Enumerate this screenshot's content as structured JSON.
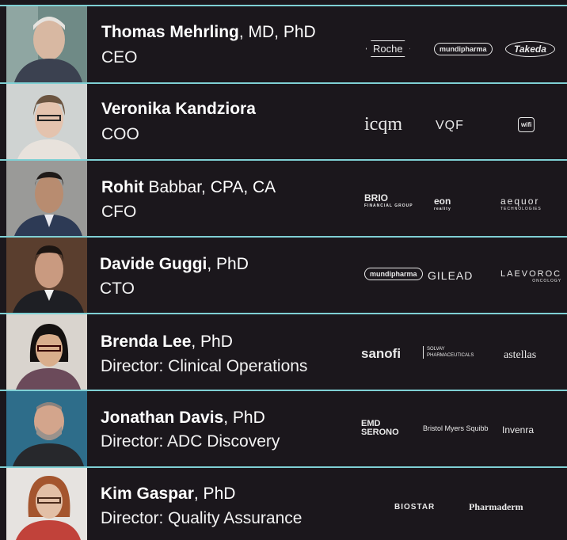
{
  "members": [
    {
      "name_bold": "Thomas Mehrling",
      "name_rest": ", MD, PhD",
      "role": "CEO",
      "logos": [
        "Roche",
        "mundipharma",
        "Takeda"
      ]
    },
    {
      "name_bold": "Veronika Kandziora",
      "name_rest": "",
      "role": "COO",
      "logos": [
        "icqm",
        "VQF",
        "wifi"
      ]
    },
    {
      "name_bold": "Rohit",
      "name_rest": " Babbar, CPA, CA",
      "role": "CFO",
      "logos": [
        "BRIO",
        "eon",
        "aequor"
      ]
    },
    {
      "name_bold": "Davide Guggi",
      "name_rest": ", PhD",
      "role": "CTO",
      "logos": [
        "mundipharma",
        "GILEAD",
        "LAEVOROC"
      ]
    },
    {
      "name_bold": "Brenda Lee",
      "name_rest": ", PhD",
      "role": "Director: Clinical Operations",
      "logos": [
        "sanofi",
        "SOLVAY PHARMACEUTICALS",
        "astellas"
      ]
    },
    {
      "name_bold": "Jonathan Davis",
      "name_rest": ", PhD",
      "role": "Director: ADC Discovery",
      "logos": [
        "EMD SERONO",
        "Bristol Myers Squibb",
        "Invenra"
      ]
    },
    {
      "name_bold": "Kim Gaspar",
      "name_rest": ", PhD",
      "role": "Director: Quality Assurance",
      "logos": [
        "BIOSTAR",
        "Pharmaderm"
      ]
    }
  ],
  "logo_subtexts": {
    "eon": "reality",
    "aequor": "TECHNOLOGIES",
    "laevoroc": "ONCOLOGY",
    "brio": "FINANCIAL GROUP"
  },
  "colors": {
    "background": "#1b171c",
    "divider": "#7fd0d4",
    "text": "#ffffff"
  }
}
